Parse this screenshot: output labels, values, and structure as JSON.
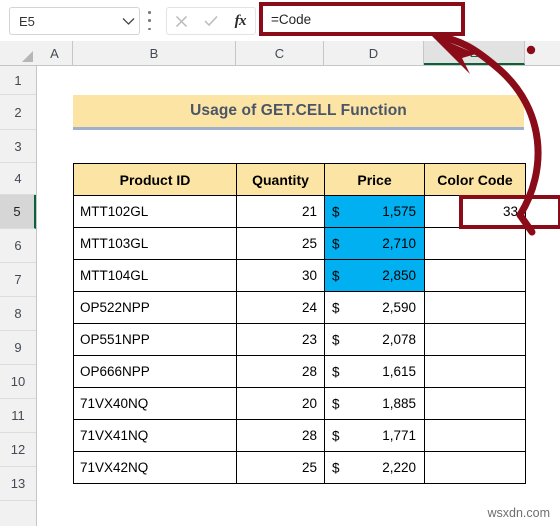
{
  "formula_bar": {
    "name_box_value": "E5",
    "formula_value": "=Code",
    "cancel_icon": "x-icon",
    "confirm_icon": "check-icon",
    "function_icon": "fx-icon",
    "dropdown_icon": "chevron-down-icon",
    "kebab_icon": "more-options-icon"
  },
  "columns": [
    {
      "label": "A",
      "selected": false
    },
    {
      "label": "B",
      "selected": false
    },
    {
      "label": "C",
      "selected": false
    },
    {
      "label": "D",
      "selected": false
    },
    {
      "label": "E",
      "selected": true
    }
  ],
  "rows": [
    "1",
    "2",
    "3",
    "4",
    "5",
    "6",
    "7",
    "8",
    "9",
    "10",
    "11",
    "12",
    "13"
  ],
  "selected_row": "5",
  "sheet": {
    "title": "Usage of GET.CELL Function",
    "headers": [
      "Product ID",
      "Quantity",
      "Price",
      "Color Code"
    ],
    "currency_symbol": "$",
    "data": [
      {
        "product_id": "MTT102GL",
        "quantity": "21",
        "price": "1,575",
        "color_code": "33",
        "price_highlighted": true
      },
      {
        "product_id": "MTT103GL",
        "quantity": "25",
        "price": "2,710",
        "color_code": "",
        "price_highlighted": true
      },
      {
        "product_id": "MTT104GL",
        "quantity": "30",
        "price": "2,850",
        "color_code": "",
        "price_highlighted": true
      },
      {
        "product_id": "OP522NPP",
        "quantity": "24",
        "price": "2,590",
        "color_code": "",
        "price_highlighted": false
      },
      {
        "product_id": "OP551NPP",
        "quantity": "23",
        "price": "2,078",
        "color_code": "",
        "price_highlighted": false
      },
      {
        "product_id": "OP666NPP",
        "quantity": "28",
        "price": "1,615",
        "color_code": "",
        "price_highlighted": false
      },
      {
        "product_id": "71VX40NQ",
        "quantity": "20",
        "price": "1,885",
        "color_code": "",
        "price_highlighted": false
      },
      {
        "product_id": "71VX41NQ",
        "quantity": "28",
        "price": "1,771",
        "color_code": "",
        "price_highlighted": false
      },
      {
        "product_id": "71VX42NQ",
        "quantity": "25",
        "price": "2,220",
        "color_code": "",
        "price_highlighted": false
      }
    ]
  },
  "annotation": {
    "color": "#8B0C19",
    "arrow_name": "annotation-arrow-e5-to-formula-bar",
    "dot_name": "annotation-dot"
  },
  "colors": {
    "header_fill": "#FCE4A4",
    "price_highlight": "#00B0F0",
    "annotation_red": "#8B0C19",
    "title_underline": "#9DB0CE",
    "selection_green": "#0B6239"
  },
  "watermark": "wsxdn.com"
}
